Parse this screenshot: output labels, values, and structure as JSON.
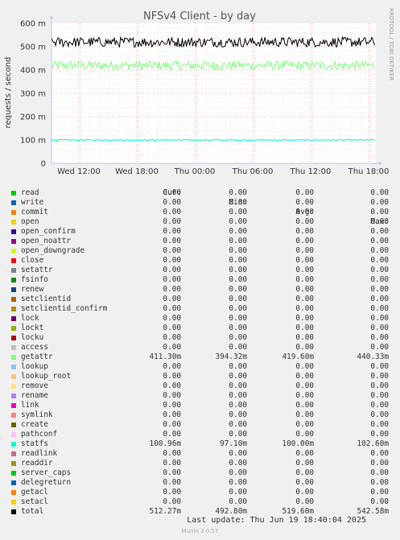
{
  "chart_data": {
    "type": "line",
    "title": "NFSv4 Client - by day",
    "ylabel": "requests / second",
    "ylim": [
      0,
      0.6
    ],
    "y_ticks": [
      {
        "value": 0,
        "label": "0"
      },
      {
        "value": 0.1,
        "label": "100 m"
      },
      {
        "value": 0.2,
        "label": "200 m"
      },
      {
        "value": 0.3,
        "label": "300 m"
      },
      {
        "value": 0.4,
        "label": "400 m"
      },
      {
        "value": 0.5,
        "label": "500 m"
      },
      {
        "value": 0.6,
        "label": "600 m"
      }
    ],
    "x_ticks": [
      "Wed 12:00",
      "Wed 18:00",
      "Thu 00:00",
      "Thu 06:00",
      "Thu 12:00",
      "Thu 18:00"
    ],
    "grid": true,
    "side_label": "RRDTOOL / TOBI OETIKER",
    "headers": [
      "Cur:",
      "Min:",
      "Avg:",
      "Max:"
    ],
    "series": [
      {
        "name": "read",
        "color": "#00cc00",
        "cur": "0.00",
        "min": "0.00",
        "avg": "0.00",
        "max": "0.00"
      },
      {
        "name": "write",
        "color": "#0066b3",
        "cur": "0.00",
        "min": "0.00",
        "avg": "0.00",
        "max": "0.00"
      },
      {
        "name": "commit",
        "color": "#ff8000",
        "cur": "0.00",
        "min": "0.00",
        "avg": "0.00",
        "max": "0.00"
      },
      {
        "name": "open",
        "color": "#ffcc00",
        "cur": "0.00",
        "min": "0.00",
        "avg": "0.00",
        "max": "0.00"
      },
      {
        "name": "open_confirm",
        "color": "#330099",
        "cur": "0.00",
        "min": "0.00",
        "avg": "0.00",
        "max": "0.00"
      },
      {
        "name": "open_noattr",
        "color": "#990099",
        "cur": "0.00",
        "min": "0.00",
        "avg": "0.00",
        "max": "0.00"
      },
      {
        "name": "open_downgrade",
        "color": "#ccff00",
        "cur": "0.00",
        "min": "0.00",
        "avg": "0.00",
        "max": "0.00"
      },
      {
        "name": "close",
        "color": "#ff0000",
        "cur": "0.00",
        "min": "0.00",
        "avg": "0.00",
        "max": "0.00"
      },
      {
        "name": "setattr",
        "color": "#808080",
        "cur": "0.00",
        "min": "0.00",
        "avg": "0.00",
        "max": "0.00"
      },
      {
        "name": "fsinfo",
        "color": "#008f00",
        "cur": "0.00",
        "min": "0.00",
        "avg": "0.00",
        "max": "0.00"
      },
      {
        "name": "renew",
        "color": "#00487d",
        "cur": "0.00",
        "min": "0.00",
        "avg": "0.00",
        "max": "0.00"
      },
      {
        "name": "setclientid",
        "color": "#b35a00",
        "cur": "0.00",
        "min": "0.00",
        "avg": "0.00",
        "max": "0.00"
      },
      {
        "name": "setclientid_confirm",
        "color": "#b38f00",
        "cur": "0.00",
        "min": "0.00",
        "avg": "0.00",
        "max": "0.00"
      },
      {
        "name": "lock",
        "color": "#6b006b",
        "cur": "0.00",
        "min": "0.00",
        "avg": "0.00",
        "max": "0.00"
      },
      {
        "name": "lockt",
        "color": "#8fb300",
        "cur": "0.00",
        "min": "0.00",
        "avg": "0.00",
        "max": "0.00"
      },
      {
        "name": "locku",
        "color": "#b30000",
        "cur": "0.00",
        "min": "0.00",
        "avg": "0.00",
        "max": "0.00"
      },
      {
        "name": "access",
        "color": "#bebebe",
        "cur": "0.00",
        "min": "0.00",
        "avg": "0.00",
        "max": "0.00"
      },
      {
        "name": "getattr",
        "color": "#80ff80",
        "cur": "411.30m",
        "min": "394.32m",
        "avg": "419.60m",
        "max": "440.33m",
        "value": 0.4196,
        "lo": 0.3943,
        "hi": 0.4403
      },
      {
        "name": "lookup",
        "color": "#80c9ff",
        "cur": "0.00",
        "min": "0.00",
        "avg": "0.00",
        "max": "0.00"
      },
      {
        "name": "lookup_root",
        "color": "#ffc080",
        "cur": "0.00",
        "min": "0.00",
        "avg": "0.00",
        "max": "0.00"
      },
      {
        "name": "remove",
        "color": "#ffe680",
        "cur": "0.00",
        "min": "0.00",
        "avg": "0.00",
        "max": "0.00"
      },
      {
        "name": "rename",
        "color": "#aa80ff",
        "cur": "0.00",
        "min": "0.00",
        "avg": "0.00",
        "max": "0.00"
      },
      {
        "name": "link",
        "color": "#ee00cc",
        "cur": "0.00",
        "min": "0.00",
        "avg": "0.00",
        "max": "0.00"
      },
      {
        "name": "symlink",
        "color": "#ff8080",
        "cur": "0.00",
        "min": "0.00",
        "avg": "0.00",
        "max": "0.00"
      },
      {
        "name": "create",
        "color": "#666600",
        "cur": "0.00",
        "min": "0.00",
        "avg": "0.00",
        "max": "0.00"
      },
      {
        "name": "pathconf",
        "color": "#ffbfff",
        "cur": "0.00",
        "min": "0.00",
        "avg": "0.00",
        "max": "0.00"
      },
      {
        "name": "statfs",
        "color": "#00ffcc",
        "cur": "100.96m",
        "min": "97.10m",
        "avg": "100.00m",
        "max": "102.60m",
        "value": 0.1,
        "lo": 0.0971,
        "hi": 0.1026
      },
      {
        "name": "readlink",
        "color": "#cc6699",
        "cur": "0.00",
        "min": "0.00",
        "avg": "0.00",
        "max": "0.00"
      },
      {
        "name": "readdir",
        "color": "#999900",
        "cur": "0.00",
        "min": "0.00",
        "avg": "0.00",
        "max": "0.00"
      },
      {
        "name": "server_caps",
        "color": "#00cc00",
        "cur": "0.00",
        "min": "0.00",
        "avg": "0.00",
        "max": "0.00"
      },
      {
        "name": "delegreturn",
        "color": "#0066b3",
        "cur": "0.00",
        "min": "0.00",
        "avg": "0.00",
        "max": "0.00"
      },
      {
        "name": "getacl",
        "color": "#ff8000",
        "cur": "0.00",
        "min": "0.00",
        "avg": "0.00",
        "max": "0.00"
      },
      {
        "name": "setacl",
        "color": "#ffcc00",
        "cur": "0.00",
        "min": "0.00",
        "avg": "0.00",
        "max": "0.00"
      },
      {
        "name": "total",
        "color": "#000000",
        "cur": "512.27m",
        "min": "492.80m",
        "avg": "519.60m",
        "max": "542.58m",
        "value": 0.5196,
        "lo": 0.4928,
        "hi": 0.5426
      }
    ],
    "last_update": "Last update: Thu Jun 19 18:40:04 2025",
    "footer": "Munin 2.0.57"
  }
}
